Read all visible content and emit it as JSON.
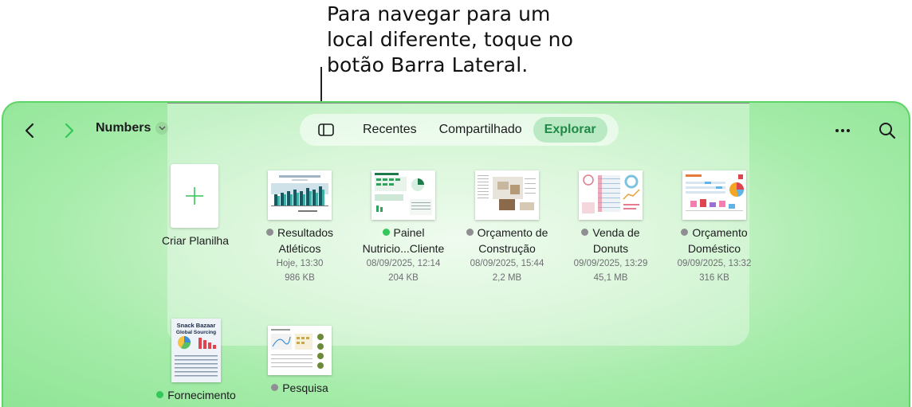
{
  "callout": {
    "text": "Para navegar para um local diferente, toque no botão Barra Lateral."
  },
  "toolbar": {
    "breadcrumb": "Numbers",
    "tabs": [
      {
        "label": "Recentes",
        "active": false
      },
      {
        "label": "Compartilhado",
        "active": false
      },
      {
        "label": "Explorar",
        "active": true
      }
    ]
  },
  "create": {
    "label": "Criar Planilha"
  },
  "documents": [
    {
      "name_line1": "Resultados",
      "name_line2": "Atléticos",
      "date": "Hoje, 13:30",
      "size": "986 KB",
      "status": "gray"
    },
    {
      "name_line1": "Painel",
      "name_line2": "Nutricio...Cliente",
      "date": "08/09/2025, 12:14",
      "size": "204 KB",
      "status": "green"
    },
    {
      "name_line1": "Orçamento de",
      "name_line2": "Construção",
      "date": "08/09/2025, 15:44",
      "size": "2,2 MB",
      "status": "gray"
    },
    {
      "name_line1": "Venda de",
      "name_line2": "Donuts",
      "date": "09/09/2025, 13:29",
      "size": "45,1 MB",
      "status": "gray"
    },
    {
      "name_line1": "Orçamento",
      "name_line2": "Doméstico",
      "date": "09/09/2025, 13:32",
      "size": "316 KB",
      "status": "gray"
    },
    {
      "name_line1": "Fornecimento",
      "name_line2": "",
      "date": "",
      "size": "",
      "status": "green",
      "thumb_title": "Snack Bazaar",
      "thumb_subtitle": "Global Sourcing"
    },
    {
      "name_line1": "Pesquisa",
      "name_line2": "",
      "date": "",
      "size": "",
      "status": "gray"
    }
  ],
  "colors": {
    "accent": "#34c759",
    "window_border": "#5fd469",
    "active_tab_text": "#1f8a47"
  }
}
